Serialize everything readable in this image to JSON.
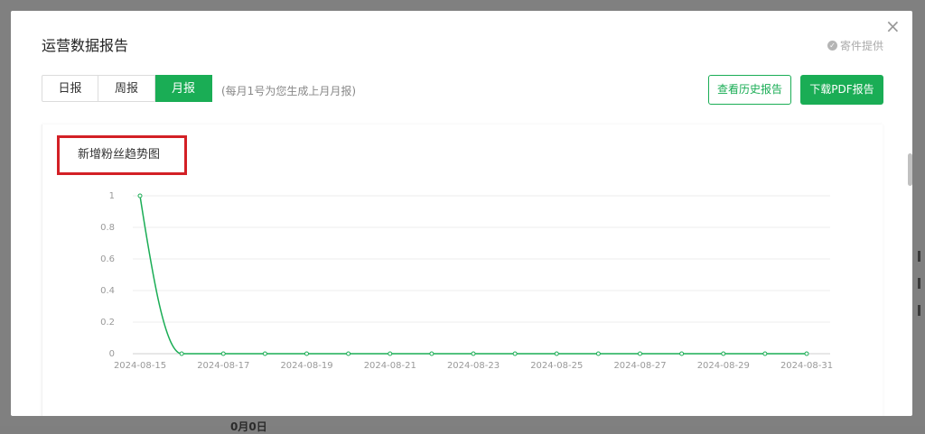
{
  "modal": {
    "title": "运营数据报告",
    "close_symbol": "×",
    "provider_text": "寄件提供"
  },
  "tabs": [
    {
      "label": "日报",
      "active": false
    },
    {
      "label": "周报",
      "active": false
    },
    {
      "label": "月报",
      "active": true
    }
  ],
  "hint": "(每月1号为您生成上月月报)",
  "buttons": {
    "history": "查看历史报告",
    "pdf": "下载PDF报告"
  },
  "chart_card": {
    "title": "新增粉丝趋势图"
  },
  "colors": {
    "accent": "#1aad55",
    "highlight_box": "#d32026"
  },
  "background": {
    "bottom_text": "0月0日"
  },
  "chart_data": {
    "type": "line",
    "title": "新增粉丝趋势图",
    "xlabel": "",
    "ylabel": "",
    "ylim": [
      0,
      1
    ],
    "y_ticks": [
      "0",
      "0.2",
      "0.4",
      "0.6",
      "0.8",
      "1"
    ],
    "x": [
      "2024-08-15",
      "2024-08-16",
      "2024-08-17",
      "2024-08-18",
      "2024-08-19",
      "2024-08-20",
      "2024-08-21",
      "2024-08-22",
      "2024-08-23",
      "2024-08-24",
      "2024-08-25",
      "2024-08-26",
      "2024-08-27",
      "2024-08-28",
      "2024-08-29",
      "2024-08-30",
      "2024-08-31"
    ],
    "x_tick_labels": [
      "2024-08-15",
      "2024-08-17",
      "2024-08-19",
      "2024-08-21",
      "2024-08-23",
      "2024-08-25",
      "2024-08-27",
      "2024-08-29",
      "2024-08-31"
    ],
    "series": [
      {
        "values": [
          1,
          0,
          0,
          0,
          0,
          0,
          0,
          0,
          0,
          0,
          0,
          0,
          0,
          0,
          0,
          0,
          0
        ],
        "color": "#1aad55"
      }
    ],
    "grid": true
  }
}
